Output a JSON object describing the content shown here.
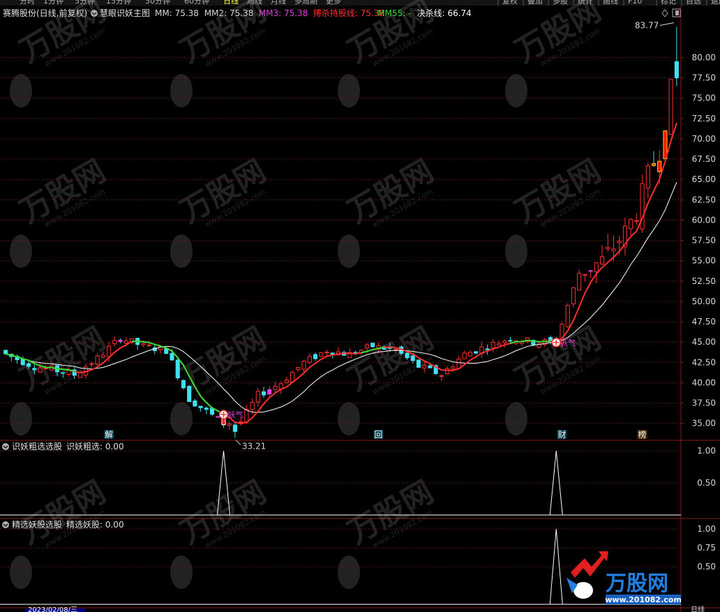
{
  "top_toolbar": {
    "left_items": [
      "分时",
      "1分钟",
      "5分钟",
      "15分钟",
      "30分钟",
      "60分钟",
      "日线",
      "周线",
      "月线",
      "多周期",
      "更多"
    ],
    "active_item": "日线",
    "right_items": [
      "复权",
      "叠加",
      "多股",
      "统计",
      "画线",
      "F10",
      "标记",
      "自选",
      "返回"
    ]
  },
  "main_panel": {
    "stock_label": "赛腾股份(日线,前复权)",
    "indicator_name": "慧眼识妖主图",
    "legend": [
      {
        "label": "MM: 75.38",
        "color": "#d8d8d8"
      },
      {
        "label": "MM2: 75.38",
        "color": "#d8d8d8"
      },
      {
        "label": "MM3: 75.38",
        "color": "#e040e0"
      },
      {
        "label": "搏杀持股线: 75.38",
        "color": "#ff3030"
      },
      {
        "label": "MM55: -",
        "color": "#30e030"
      },
      {
        "label": "决杀线: 66.74",
        "color": "#ffffff"
      }
    ],
    "y_ticks": [
      35.0,
      37.5,
      40.0,
      42.5,
      45.0,
      47.5,
      50.0,
      52.5,
      55.0,
      57.5,
      60.0,
      62.5,
      65.0,
      67.5,
      70.0,
      72.5,
      75.0,
      77.5,
      80.0
    ],
    "annotations": {
      "high": "83.77",
      "low": "33.21",
      "signal_text": "妖气"
    },
    "markers": [
      {
        "label": "解",
        "color": "#00b0d0"
      },
      {
        "label": "回",
        "color": "#00b0d0"
      },
      {
        "label": "财",
        "color": "#00b0d0"
      },
      {
        "label": "榜",
        "color": "#d08000"
      }
    ]
  },
  "sub_panel_1": {
    "title": "识妖粗选选股",
    "value_label": "识妖粗选: 0.00",
    "y_ticks": [
      0.5,
      1.0
    ]
  },
  "sub_panel_2": {
    "title": "精选妖股选股",
    "value_label": "精选妖股: 0.00",
    "y_ticks": [
      0.5,
      0.75,
      1.0
    ]
  },
  "bottom_bar": {
    "date_text": "2023/02/08/三",
    "right_label": "日线"
  },
  "watermark": {
    "brand": "万股网",
    "url": "www.201082.com"
  },
  "colors": {
    "up": "#ff3030",
    "down": "#40e0f0",
    "accent_magenta": "#e040e0",
    "grid": "#8b1a1a",
    "gold": "#ffd700"
  },
  "chart_data": {
    "type": "candlestick",
    "ylim": [
      33.0,
      84.5
    ],
    "n_bars": 118,
    "yao_score_series": [
      {
        "name": "识妖粗选",
        "spikes": [
          {
            "bar": 38,
            "value": 1.0
          },
          {
            "bar": 96,
            "value": 1.0
          }
        ]
      },
      {
        "name": "精选妖股",
        "spikes": [
          {
            "bar": 96,
            "value": 1.0
          }
        ]
      }
    ],
    "ma_lines": [
      {
        "name": "搏杀持股线",
        "color": "#ff3030"
      },
      {
        "name": "决杀线",
        "color": "#ffffff"
      }
    ]
  }
}
